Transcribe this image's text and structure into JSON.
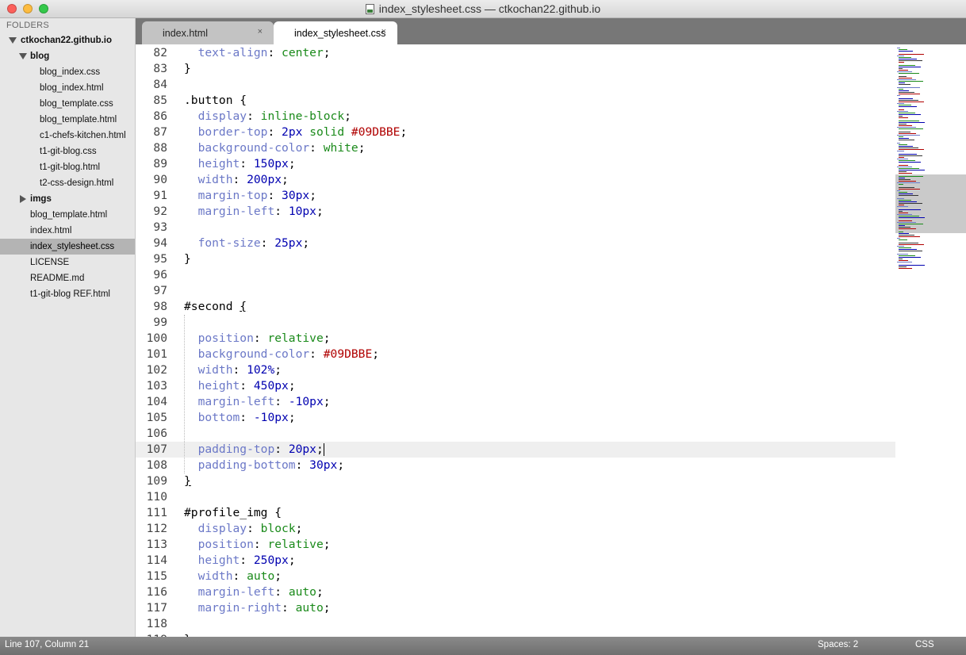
{
  "window": {
    "title": "index_stylesheet.css — ctkochan22.github.io"
  },
  "sidebar": {
    "header": "FOLDERS",
    "root": "ctkochan22.github.io",
    "blog_folder": "blog",
    "blog_files": [
      "blog_index.css",
      "blog_index.html",
      "blog_template.css",
      "blog_template.html",
      "c1-chefs-kitchen.html",
      "t1-git-blog.css",
      "t1-git-blog.html",
      "t2-css-design.html"
    ],
    "imgs_folder": "imgs",
    "root_files": [
      "blog_template.html",
      "index.html",
      "index_stylesheet.css",
      "LICENSE",
      "README.md",
      "t1-git-blog REF.html"
    ],
    "selected_file": "index_stylesheet.css"
  },
  "tabs": [
    {
      "label": "index.html",
      "active": false,
      "close": "×"
    },
    {
      "label": "index_stylesheet.css",
      "active": true,
      "close": "×"
    }
  ],
  "editor": {
    "current_line": 107,
    "lines": [
      {
        "num": "82",
        "tokens": [
          [
            "  ",
            ""
          ],
          [
            "text-align",
            "k"
          ],
          [
            ": ",
            ""
          ],
          [
            "center",
            "v"
          ],
          [
            ";",
            ""
          ]
        ]
      },
      {
        "num": "83",
        "tokens": [
          [
            "}",
            ""
          ]
        ]
      },
      {
        "num": "84",
        "tokens": []
      },
      {
        "num": "85",
        "tokens": [
          [
            ".button {",
            ""
          ]
        ]
      },
      {
        "num": "86",
        "tokens": [
          [
            "  ",
            ""
          ],
          [
            "display",
            "k"
          ],
          [
            ": ",
            ""
          ],
          [
            "inline-block",
            "v"
          ],
          [
            ";",
            ""
          ]
        ]
      },
      {
        "num": "87",
        "tokens": [
          [
            "  ",
            ""
          ],
          [
            "border-top",
            "k"
          ],
          [
            ": ",
            ""
          ],
          [
            "2px",
            "n"
          ],
          [
            " ",
            ""
          ],
          [
            "solid",
            "v"
          ],
          [
            " ",
            ""
          ],
          [
            "#09DBBE",
            "h"
          ],
          [
            ";",
            ""
          ]
        ]
      },
      {
        "num": "88",
        "tokens": [
          [
            "  ",
            ""
          ],
          [
            "background-color",
            "k"
          ],
          [
            ": ",
            ""
          ],
          [
            "white",
            "v"
          ],
          [
            ";",
            ""
          ]
        ]
      },
      {
        "num": "89",
        "tokens": [
          [
            "  ",
            ""
          ],
          [
            "height",
            "k"
          ],
          [
            ": ",
            ""
          ],
          [
            "150px",
            "n"
          ],
          [
            ";",
            ""
          ]
        ]
      },
      {
        "num": "90",
        "tokens": [
          [
            "  ",
            ""
          ],
          [
            "width",
            "k"
          ],
          [
            ": ",
            ""
          ],
          [
            "200px",
            "n"
          ],
          [
            ";",
            ""
          ]
        ]
      },
      {
        "num": "91",
        "tokens": [
          [
            "  ",
            ""
          ],
          [
            "margin-top",
            "k"
          ],
          [
            ": ",
            ""
          ],
          [
            "30px",
            "n"
          ],
          [
            ";",
            ""
          ]
        ]
      },
      {
        "num": "92",
        "tokens": [
          [
            "  ",
            ""
          ],
          [
            "margin-left",
            "k"
          ],
          [
            ": ",
            ""
          ],
          [
            "10px",
            "n"
          ],
          [
            ";",
            ""
          ]
        ]
      },
      {
        "num": "93",
        "tokens": []
      },
      {
        "num": "94",
        "tokens": [
          [
            "  ",
            ""
          ],
          [
            "font-size",
            "k"
          ],
          [
            ": ",
            ""
          ],
          [
            "25px",
            "n"
          ],
          [
            ";",
            ""
          ]
        ]
      },
      {
        "num": "95",
        "tokens": [
          [
            "}",
            ""
          ]
        ]
      },
      {
        "num": "96",
        "tokens": []
      },
      {
        "num": "97",
        "tokens": []
      },
      {
        "num": "98",
        "tokens": [
          [
            "#second ",
            ""
          ],
          [
            "{",
            "u"
          ]
        ]
      },
      {
        "num": "99",
        "tokens": []
      },
      {
        "num": "100",
        "tokens": [
          [
            "  ",
            ""
          ],
          [
            "position",
            "k"
          ],
          [
            ": ",
            ""
          ],
          [
            "relative",
            "v"
          ],
          [
            ";",
            ""
          ]
        ]
      },
      {
        "num": "101",
        "tokens": [
          [
            "  ",
            ""
          ],
          [
            "background-color",
            "k"
          ],
          [
            ": ",
            ""
          ],
          [
            "#09DBBE",
            "h"
          ],
          [
            ";",
            ""
          ]
        ]
      },
      {
        "num": "102",
        "tokens": [
          [
            "  ",
            ""
          ],
          [
            "width",
            "k"
          ],
          [
            ": ",
            ""
          ],
          [
            "102%",
            "n"
          ],
          [
            ";",
            ""
          ]
        ]
      },
      {
        "num": "103",
        "tokens": [
          [
            "  ",
            ""
          ],
          [
            "height",
            "k"
          ],
          [
            ": ",
            ""
          ],
          [
            "450px",
            "n"
          ],
          [
            ";",
            ""
          ]
        ]
      },
      {
        "num": "104",
        "tokens": [
          [
            "  ",
            ""
          ],
          [
            "margin-left",
            "k"
          ],
          [
            ": ",
            ""
          ],
          [
            "-10px",
            "n"
          ],
          [
            ";",
            ""
          ]
        ]
      },
      {
        "num": "105",
        "tokens": [
          [
            "  ",
            ""
          ],
          [
            "bottom",
            "k"
          ],
          [
            ": ",
            ""
          ],
          [
            "-10px",
            "n"
          ],
          [
            ";",
            ""
          ]
        ]
      },
      {
        "num": "106",
        "tokens": []
      },
      {
        "num": "107",
        "tokens": [
          [
            "  ",
            ""
          ],
          [
            "padding-top",
            "k"
          ],
          [
            ": ",
            ""
          ],
          [
            "20px",
            "n"
          ],
          [
            ";",
            ""
          ],
          [
            "",
            "caret"
          ]
        ]
      },
      {
        "num": "108",
        "tokens": [
          [
            "  ",
            ""
          ],
          [
            "padding-bottom",
            "k"
          ],
          [
            ": ",
            ""
          ],
          [
            "30px",
            "n"
          ],
          [
            ";",
            ""
          ]
        ]
      },
      {
        "num": "109",
        "tokens": [
          [
            "}",
            "u"
          ]
        ]
      },
      {
        "num": "110",
        "tokens": []
      },
      {
        "num": "111",
        "tokens": [
          [
            "#profile_img {",
            ""
          ]
        ]
      },
      {
        "num": "112",
        "tokens": [
          [
            "  ",
            ""
          ],
          [
            "display",
            "k"
          ],
          [
            ": ",
            ""
          ],
          [
            "block",
            "v"
          ],
          [
            ";",
            ""
          ]
        ]
      },
      {
        "num": "113",
        "tokens": [
          [
            "  ",
            ""
          ],
          [
            "position",
            "k"
          ],
          [
            ": ",
            ""
          ],
          [
            "relative",
            "v"
          ],
          [
            ";",
            ""
          ]
        ]
      },
      {
        "num": "114",
        "tokens": [
          [
            "  ",
            ""
          ],
          [
            "height",
            "k"
          ],
          [
            ": ",
            ""
          ],
          [
            "250px",
            "n"
          ],
          [
            ";",
            ""
          ]
        ]
      },
      {
        "num": "115",
        "tokens": [
          [
            "  ",
            ""
          ],
          [
            "width",
            "k"
          ],
          [
            ": ",
            ""
          ],
          [
            "auto",
            "v"
          ],
          [
            ";",
            ""
          ]
        ]
      },
      {
        "num": "116",
        "tokens": [
          [
            "  ",
            ""
          ],
          [
            "margin-left",
            "k"
          ],
          [
            ": ",
            ""
          ],
          [
            "auto",
            "v"
          ],
          [
            ";",
            ""
          ]
        ]
      },
      {
        "num": "117",
        "tokens": [
          [
            "  ",
            ""
          ],
          [
            "margin-right",
            "k"
          ],
          [
            ": ",
            ""
          ],
          [
            "auto",
            "v"
          ],
          [
            ";",
            ""
          ]
        ]
      },
      {
        "num": "118",
        "tokens": []
      },
      {
        "num": "119",
        "tokens": [
          [
            "}",
            ""
          ]
        ]
      }
    ]
  },
  "statusbar": {
    "position": "Line 107, Column 21",
    "indent": "Spaces: 2",
    "syntax": "CSS"
  },
  "colors": {
    "property": "#6b78c7",
    "value": "#1a8a1a",
    "number": "#0000b0",
    "hex": "#b00000"
  }
}
